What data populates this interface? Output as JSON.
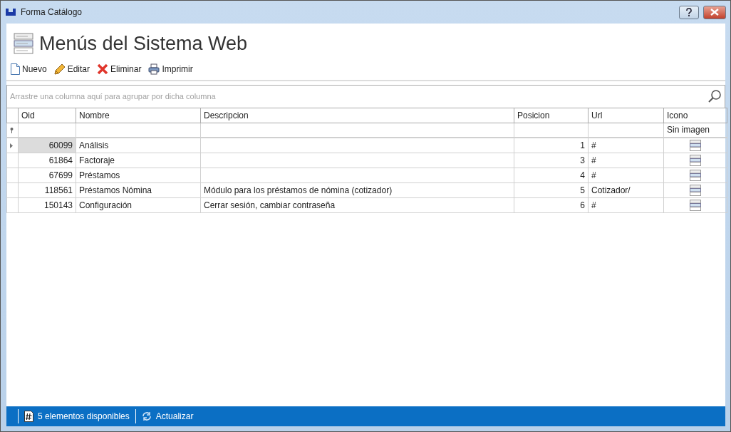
{
  "window": {
    "title": "Forma Catálogo"
  },
  "header": {
    "title": "Menús del Sistema Web"
  },
  "toolbar": [
    {
      "kind": "new",
      "label": "Nuevo"
    },
    {
      "kind": "edit",
      "label": "Editar"
    },
    {
      "kind": "delete",
      "label": "Eliminar"
    },
    {
      "kind": "print",
      "label": "Imprimir"
    }
  ],
  "group_panel": {
    "placeholder": "Arrastre una columna aquí para agrupar por dicha columna"
  },
  "table": {
    "columns": [
      {
        "label": "Oid",
        "kind": "number"
      },
      {
        "label": "Nombre",
        "kind": "text"
      },
      {
        "label": "Descripcion",
        "kind": "text"
      },
      {
        "label": "Posicion",
        "kind": "number"
      },
      {
        "label": "Url",
        "kind": "text"
      },
      {
        "label": "Icono",
        "kind": "image",
        "filter": "Sin imagen"
      }
    ],
    "rows": [
      {
        "selected": true,
        "cells": [
          "60099",
          "Análisis",
          "",
          "1",
          "#"
        ]
      },
      {
        "selected": false,
        "cells": [
          "61864",
          "Factoraje",
          "",
          "3",
          "#"
        ]
      },
      {
        "selected": false,
        "cells": [
          "67699",
          "Préstamos",
          "",
          "4",
          "#"
        ]
      },
      {
        "selected": false,
        "cells": [
          "118561",
          "Préstamos Nómina",
          "Módulo para los préstamos de nómina (cotizador)",
          "5",
          "Cotizador/"
        ]
      },
      {
        "selected": false,
        "cells": [
          "150143",
          "Configuración",
          "Cerrar sesión, cambiar contraseña",
          "6",
          "#"
        ]
      }
    ]
  },
  "status_bar": {
    "count": "5 elementos disponibles",
    "refresh": "Actualizar"
  }
}
